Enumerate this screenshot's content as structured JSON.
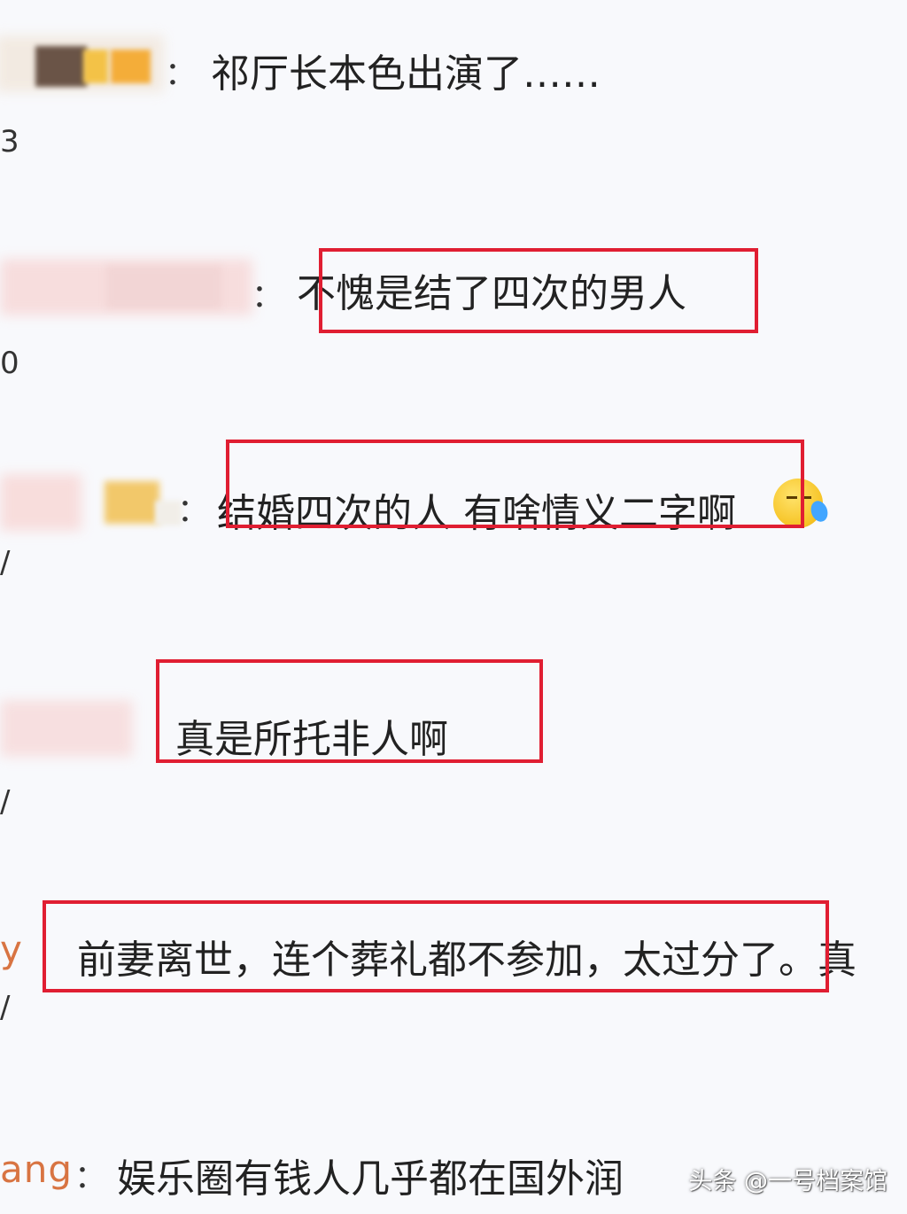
{
  "comments": [
    {
      "text": "祁厅长本色出演了……",
      "meta": "3"
    },
    {
      "text": "不愧是结了四次的男人",
      "meta": "0"
    },
    {
      "text": "结婚四次的人 有啥情义二字啊",
      "meta": "/",
      "emoji": "sweat-smile-icon"
    },
    {
      "text": "真是所托非人啊",
      "meta": "/"
    },
    {
      "username_fragment": "y",
      "text": "前妻离世，连个葬礼都不参加，太过分了。真",
      "meta": "/"
    },
    {
      "username_fragment": "ang",
      "text": "娱乐圈有钱人几乎都在国外润"
    }
  ],
  "separators": {
    "colon": "："
  },
  "watermark": "头条 @一号档案馆",
  "colors": {
    "highlight": "#e01e32",
    "username": "#d87442",
    "background": "#f8f9fc"
  }
}
